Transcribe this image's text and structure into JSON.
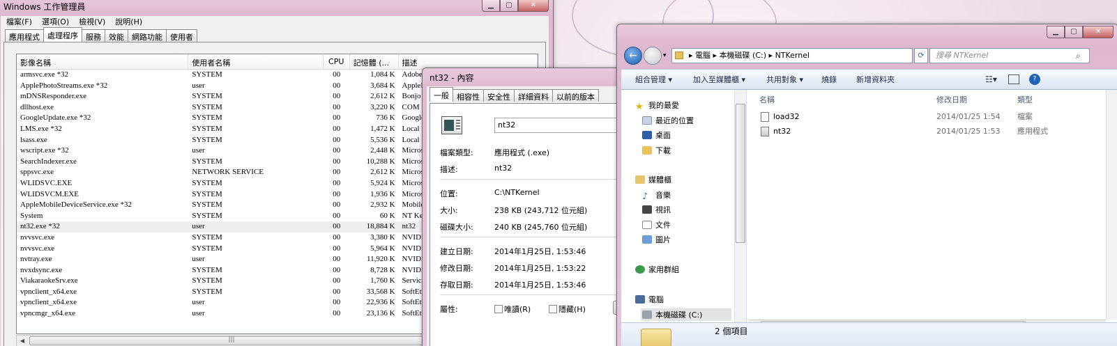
{
  "task_manager": {
    "title": "Windows 工作管理員",
    "menu": [
      "檔案(F)",
      "選項(O)",
      "檢視(V)",
      "說明(H)"
    ],
    "tabs": [
      "應用程式",
      "處理程序",
      "服務",
      "效能",
      "網路功能",
      "使用者"
    ],
    "active_tab": "處理程序",
    "columns": [
      "影像名稱",
      "使用者名稱",
      "CPU",
      "記憶體 (...",
      "描述"
    ],
    "processes": [
      [
        "armsvc.exe *32",
        "SYSTEM",
        "00",
        "1,084 K",
        "Adobe"
      ],
      [
        "ApplePhotoStreams.exe *32",
        "user",
        "00",
        "3,684 K",
        "AppleP"
      ],
      [
        "mDNSResponder.exe",
        "SYSTEM",
        "00",
        "2,612 K",
        "Bonjo"
      ],
      [
        "dllhost.exe",
        "SYSTEM",
        "00",
        "3,220 K",
        "COM S"
      ],
      [
        "GoogleUpdate.exe *32",
        "SYSTEM",
        "00",
        "736 K",
        "Google"
      ],
      [
        "LMS.exe *32",
        "SYSTEM",
        "00",
        "1,472 K",
        "Local M"
      ],
      [
        "lsass.exe",
        "SYSTEM",
        "00",
        "5,536 K",
        "Local S"
      ],
      [
        "wscript.exe *32",
        "user",
        "00",
        "2,448 K",
        "Micros"
      ],
      [
        "SearchIndexer.exe",
        "SYSTEM",
        "00",
        "10,288 K",
        "Micros"
      ],
      [
        "sppsvc.exe",
        "NETWORK SERVICE",
        "00",
        "2,612 K",
        "Micros"
      ],
      [
        "WLIDSVC.EXE",
        "SYSTEM",
        "00",
        "5,924 K",
        "Micros"
      ],
      [
        "WLIDSVCM.EXE",
        "SYSTEM",
        "00",
        "1,936 K",
        "Micros"
      ],
      [
        "AppleMobileDeviceService.exe *32",
        "SYSTEM",
        "00",
        "2,932 K",
        "Mobile"
      ],
      [
        "System",
        "SYSTEM",
        "00",
        "60 K",
        "NT Ke"
      ],
      [
        "nt32.exe *32",
        "user",
        "00",
        "18,884 K",
        "nt32"
      ],
      [
        "nvvsvc.exe",
        "SYSTEM",
        "00",
        "3,380 K",
        "NVIDI"
      ],
      [
        "nvvsvc.exe",
        "SYSTEM",
        "00",
        "5,964 K",
        "NVIDI"
      ],
      [
        "nvtray.exe",
        "user",
        "00",
        "11,920 K",
        "NVIDI"
      ],
      [
        "nvxdsync.exe",
        "SYSTEM",
        "00",
        "8,728 K",
        "NVIDI"
      ],
      [
        "ViakaraokeSrv.exe",
        "SYSTEM",
        "00",
        "1,760 K",
        "Service"
      ],
      [
        "vpnclient_x64.exe",
        "SYSTEM",
        "00",
        "33,568 K",
        "SoftEth"
      ],
      [
        "vpnclient_x64.exe",
        "user",
        "00",
        "22,936 K",
        "SoftEth"
      ],
      [
        "vpncmgr_x64.exe",
        "user",
        "00",
        "23,136 K",
        "SoftEth"
      ]
    ]
  },
  "properties": {
    "title": "nt32 - 內容",
    "tabs": [
      "一般",
      "相容性",
      "安全性",
      "詳細資料",
      "以前的版本"
    ],
    "name_value": "nt32",
    "file_type_label": "檔案類型:",
    "file_type": "應用程式 (.exe)",
    "desc_label": "描述:",
    "desc": "nt32",
    "location_label": "位置:",
    "location": "C:\\NTKernel",
    "size_label": "大小:",
    "size": "238 KB (243,712 位元組)",
    "disk_size_label": "磁碟大小:",
    "disk_size": "240 KB (245,760 位元組)",
    "created_label": "建立日期:",
    "created": "2014年1月25日, 1:53:46",
    "modified_label": "修改日期:",
    "modified": "2014年1月25日, 1:53:22",
    "accessed_label": "存取日期:",
    "accessed": "2014年1月25日, 1:53:46",
    "attr_label": "屬性:",
    "readonly": "唯讀(R)",
    "hidden": "隱藏(H)"
  },
  "explorer": {
    "breadcrumb": [
      "電腦",
      "本機磁碟 (C:)",
      "NTKernel"
    ],
    "search_placeholder": "搜尋 NTKernel",
    "toolbar": [
      "組合管理 ▾",
      "加入至媒體櫃 ▾",
      "共用對象 ▾",
      "燒錄",
      "新增資料夾"
    ],
    "nav": {
      "favorites": "我的最愛",
      "recent": "最近的位置",
      "desktop": "桌面",
      "downloads": "下載",
      "libraries": "媒體櫃",
      "music": "音樂",
      "videos": "視訊",
      "documents": "文件",
      "pictures": "圖片",
      "homegroup": "家用群組",
      "computer": "電腦",
      "local_disk": "本機磁碟 (C:)"
    },
    "columns": [
      "名稱",
      "修改日期",
      "類型"
    ],
    "files": [
      {
        "name": "load32",
        "date": "2014/01/25 1:54",
        "type": "檔案"
      },
      {
        "name": "nt32",
        "date": "2014/01/25 1:53",
        "type": "應用程式"
      }
    ],
    "status": "2 個項目"
  }
}
